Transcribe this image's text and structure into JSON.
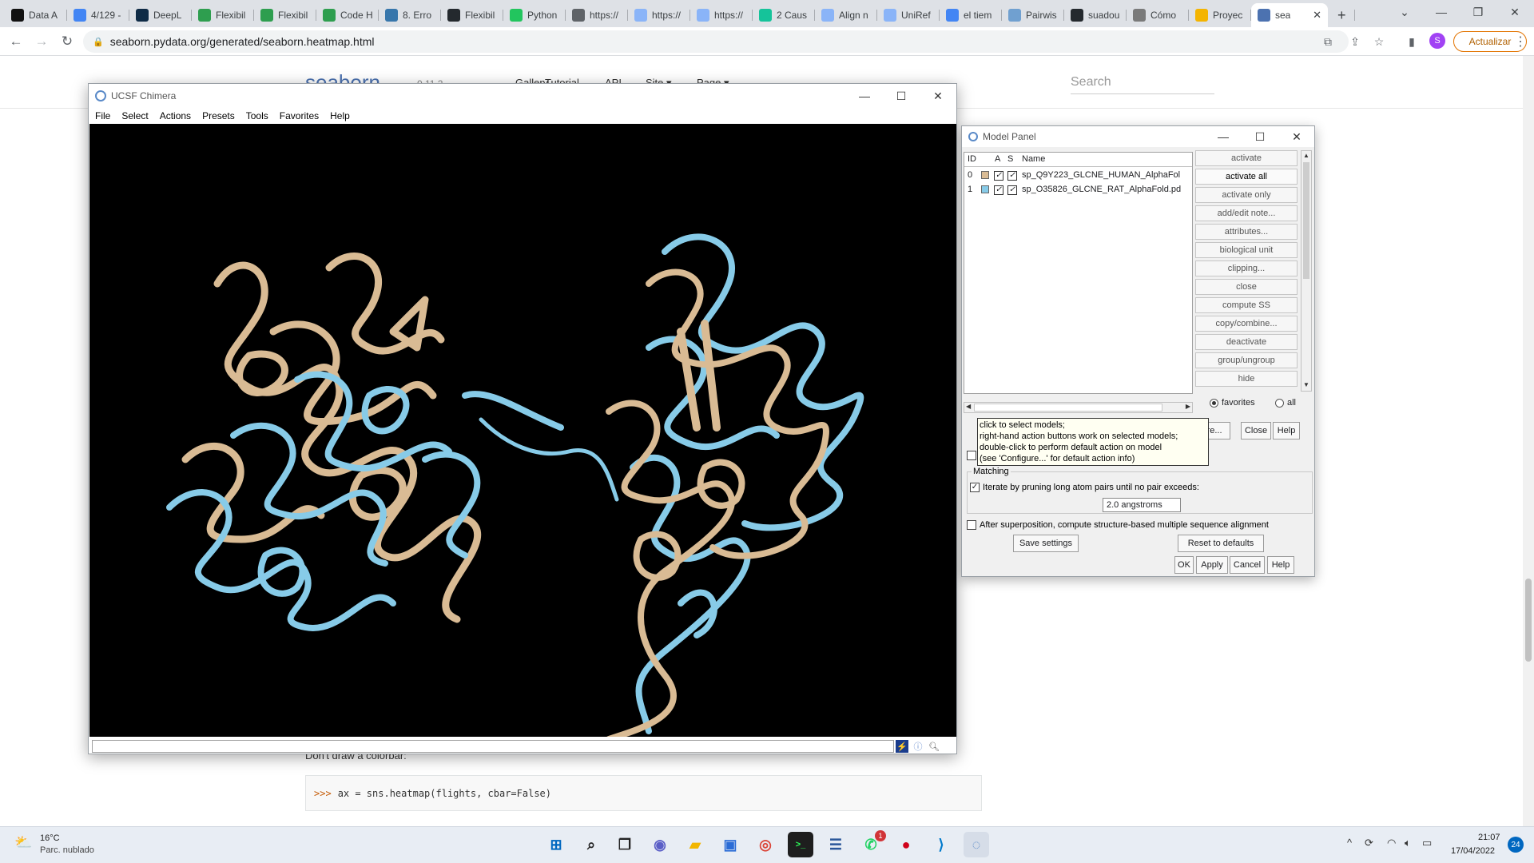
{
  "browser": {
    "tabs": [
      {
        "label": "Data A",
        "icon": "tcb-favicon",
        "color": "#111111"
      },
      {
        "label": "4/129 -",
        "icon": "google-favicon",
        "color": "#4285f4"
      },
      {
        "label": "DeepL",
        "icon": "deepl-favicon",
        "color": "#0f2b46"
      },
      {
        "label": "Flexibil",
        "icon": "leaf-favicon",
        "color": "#2e9e4f"
      },
      {
        "label": "Flexibil",
        "icon": "leaf-favicon",
        "color": "#2e9e4f"
      },
      {
        "label": "Code H",
        "icon": "leaf-favicon",
        "color": "#2e9e4f"
      },
      {
        "label": "8. Erro",
        "icon": "python-favicon",
        "color": "#3776ab"
      },
      {
        "label": "Flexibil",
        "icon": "github-favicon",
        "color": "#24292e"
      },
      {
        "label": "Python",
        "icon": "rstudio-favicon",
        "color": "#22c55e"
      },
      {
        "label": "https://",
        "icon": "globe-favicon",
        "color": "#5f6368"
      },
      {
        "label": "https://",
        "icon": "loading-favicon",
        "color": "#8ab4f8"
      },
      {
        "label": "https://",
        "icon": "loading-favicon",
        "color": "#8ab4f8"
      },
      {
        "label": "2 Caus",
        "icon": "grammarly-favicon",
        "color": "#15c39a"
      },
      {
        "label": "Align n",
        "icon": "loading-favicon",
        "color": "#8ab4f8"
      },
      {
        "label": "UniRef",
        "icon": "loading-favicon",
        "color": "#8ab4f8"
      },
      {
        "label": "el tiem",
        "icon": "google-favicon",
        "color": "#4285f4"
      },
      {
        "label": "Pairwis",
        "icon": "ebi-favicon",
        "color": "#70a0d0"
      },
      {
        "label": "suadou",
        "icon": "github-favicon",
        "color": "#24292e"
      },
      {
        "label": "Cómo",
        "icon": "doc-favicon",
        "color": "#7a7a7a"
      },
      {
        "label": "Proyec",
        "icon": "drive-favicon",
        "color": "#f4b400"
      },
      {
        "label": "sea",
        "icon": "seaborn-favicon",
        "color": "#4c72b0"
      }
    ],
    "new_tab": "+",
    "url": "seaborn.pydata.org/generated/seaborn.heatmap.html",
    "profile_initial": "S",
    "update_label": "Actualizar"
  },
  "seaborn_page": {
    "logo": "seaborn",
    "version": "0.11.2",
    "nav": [
      "Gallery",
      "Tutorial",
      "API",
      "Site ▾",
      "Page ▾"
    ],
    "search_placeholder": "Search",
    "text": "Don't draw a colorbar:",
    "code_prompt": ">>>",
    "code": "ax = sns.heatmap(flights, cbar=False)"
  },
  "chimera": {
    "title": "UCSF Chimera",
    "menus": [
      "File",
      "Select",
      "Actions",
      "Presets",
      "Tools",
      "Favorites",
      "Help"
    ],
    "colors": {
      "model0": "#d9bb94",
      "model1": "#87cbe8",
      "background": "#000000"
    }
  },
  "model_panel": {
    "title": "Model Panel",
    "headers": {
      "id": "ID",
      "active": "A",
      "shown": "S",
      "name": "Name"
    },
    "models": [
      {
        "id": "0",
        "name": "sp_Q9Y223_GLCNE_HUMAN_AlphaFol",
        "color": "#d9bb94"
      },
      {
        "id": "1",
        "name": "sp_O35826_GLCNE_RAT_AlphaFold.pd",
        "color": "#87cbe8"
      }
    ],
    "actions": [
      {
        "label": "activate",
        "enabled": false
      },
      {
        "label": "activate all",
        "enabled": true
      },
      {
        "label": "activate only",
        "enabled": false
      },
      {
        "label": "add/edit note...",
        "enabled": false
      },
      {
        "label": "attributes...",
        "enabled": false
      },
      {
        "label": "biological unit",
        "enabled": false
      },
      {
        "label": "clipping...",
        "enabled": false
      },
      {
        "label": "close",
        "enabled": false
      },
      {
        "label": "compute SS",
        "enabled": false
      },
      {
        "label": "copy/combine...",
        "enabled": false
      },
      {
        "label": "deactivate",
        "enabled": false
      },
      {
        "label": "group/ungroup",
        "enabled": false
      },
      {
        "label": "hide",
        "enabled": false
      }
    ],
    "radio_favorites": "favorites",
    "radio_all": "all",
    "configure_label": "ure...",
    "close_label": "Close",
    "help_label": "Help"
  },
  "tooltip": {
    "lines": [
      "click to select models;",
      "right-hand action buttons work on selected models;",
      "double-click to perform default action on model",
      "(see 'Configure...' for default action info)"
    ]
  },
  "matchmaker": {
    "matching_label": "Matching",
    "iterate_label": "Iterate by pruning long atom pairs until no pair exceeds:",
    "angstrom_value": "2.0 angstroms",
    "after_label": "After superposition, compute structure-based multiple sequence alignment",
    "save_label": "Save settings",
    "reset_label": "Reset to defaults",
    "ok_label": "OK",
    "apply_label": "Apply",
    "cancel_label": "Cancel",
    "help_label": "Help"
  },
  "taskbar": {
    "temperature": "16°C",
    "weather": "Parc. nublado",
    "time": "21:07",
    "date": "17/04/2022",
    "notifications": "24",
    "whatsapp_badge": "1"
  }
}
